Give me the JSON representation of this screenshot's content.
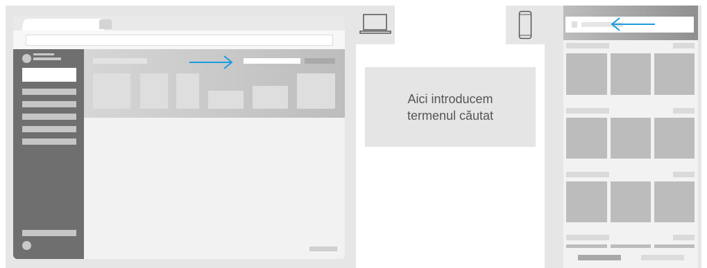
{
  "callout": {
    "text_line1": "Aici introducem",
    "text_line2": "termenul căutat"
  },
  "devices": {
    "desktop_icon": "laptop-icon",
    "mobile_icon": "smartphone-icon"
  },
  "arrows": {
    "desktop_direction": "right",
    "mobile_direction": "left",
    "color": "#1a9be0"
  },
  "colors": {
    "frame": "#e6e6e6",
    "sidebar": "#6f6f6f",
    "header_band": "#c9c9c9",
    "content_bg": "#f2f2f3",
    "callout_bg": "#e5e5e5",
    "accent": "#1a9be0"
  }
}
